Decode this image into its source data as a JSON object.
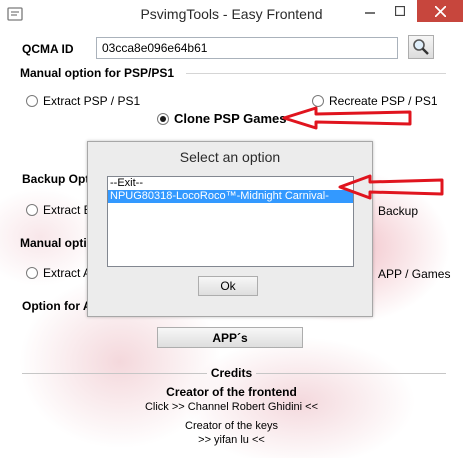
{
  "window": {
    "title": "PsvimgTools - Easy Frontend",
    "icon": "app-icon",
    "controls": [
      "minimize-icon",
      "maximize-icon",
      "close-icon"
    ]
  },
  "qcma": {
    "label": "QCMA ID",
    "value": "03cca8e096e64b61",
    "search_icon": "magnifier-icon"
  },
  "psp_section": {
    "title": "Manual option for PSP/PS1",
    "extract_label": "Extract PSP / PS1",
    "recreate_label": "Recreate PSP / PS1",
    "clone_label": "Clone PSP Games",
    "selected": "clone"
  },
  "backup_section": {
    "title_visible": "Backup Opt",
    "extract_visible": "Extract B",
    "right_visible": "Backup"
  },
  "manual_section": {
    "title_visible": "Manual optio",
    "extract_visible": "Extract A",
    "right_visible": "APP / Games"
  },
  "option_section": {
    "title_visible": "Option for A"
  },
  "apps_button": {
    "label": "APP´s"
  },
  "credits": {
    "title": "Credits",
    "frontend_heading": "Creator of the frontend",
    "frontend_text": "Click >> Channel Robert Ghidini <<",
    "keys_heading": "Creator of the keys",
    "keys_text": ">> yifan lu <<"
  },
  "dialog": {
    "title": "Select an option",
    "items": [
      "--Exit--",
      "NPUG80318-LocoRoco™-Midnight Carnival-"
    ],
    "selected_index": 1,
    "ok_label": "Ok"
  },
  "colors": {
    "close_button": "#c7463d",
    "selection": "#3399ff",
    "annotation_arrow": "#e0141e"
  }
}
